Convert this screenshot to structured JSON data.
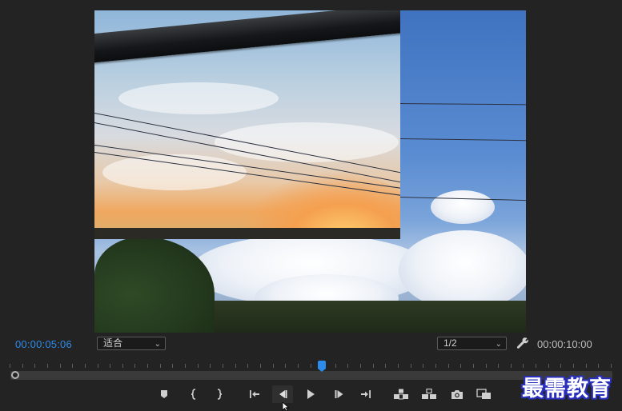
{
  "program_monitor": {
    "current_timecode": "00:00:05:06",
    "duration_timecode": "00:00:10:00",
    "zoom": {
      "selected": "适合"
    },
    "resolution": {
      "selected": "1/2"
    },
    "playhead_position": 0.5,
    "accent_color": "#2d8ceb"
  },
  "transport_buttons": [
    {
      "name": "add-marker-button",
      "icon": "marker-icon"
    },
    {
      "name": "mark-in-button",
      "icon": "mark-in-icon"
    },
    {
      "name": "mark-out-button",
      "icon": "mark-out-icon"
    },
    {
      "name": "go-to-in-button",
      "icon": "go-to-in-icon"
    },
    {
      "name": "step-back-button",
      "icon": "step-back-icon"
    },
    {
      "name": "play-button",
      "icon": "play-icon"
    },
    {
      "name": "step-forward-button",
      "icon": "step-forward-icon"
    },
    {
      "name": "go-to-out-button",
      "icon": "go-to-out-icon"
    },
    {
      "name": "lift-button",
      "icon": "lift-icon"
    },
    {
      "name": "extract-button",
      "icon": "extract-icon"
    },
    {
      "name": "export-frame-button",
      "icon": "camera-icon"
    },
    {
      "name": "compare-view-button",
      "icon": "compare-icon"
    }
  ],
  "watermark": {
    "text": "最需教育"
  }
}
